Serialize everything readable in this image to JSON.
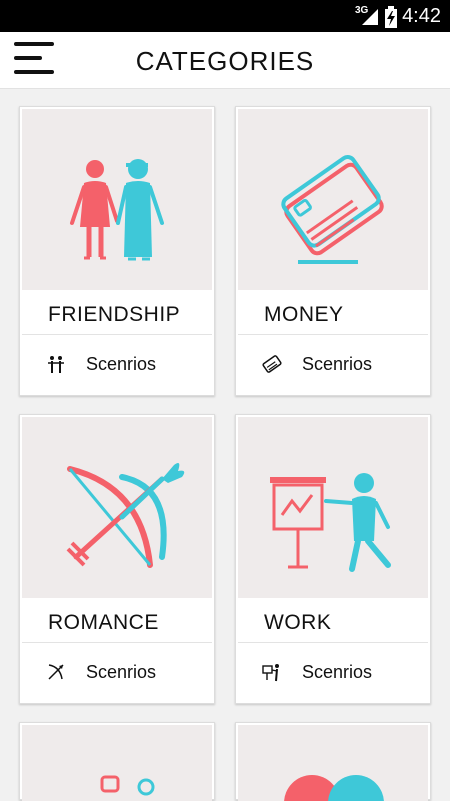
{
  "status_bar": {
    "network": "3G",
    "time": "4:42",
    "icons": [
      "signal-icon",
      "battery-charging-icon"
    ]
  },
  "header": {
    "title": "CATEGORIES",
    "menu_icon": "hamburger-menu-icon"
  },
  "categories": [
    {
      "name": "FRIENDSHIP",
      "scenarios_label": "Scenrios",
      "icon": "friends-icon"
    },
    {
      "name": "MONEY",
      "scenarios_label": "Scenrios",
      "icon": "credit-card-icon"
    },
    {
      "name": "ROMANCE",
      "scenarios_label": "Scenrios",
      "icon": "bow-arrow-icon"
    },
    {
      "name": "WORK",
      "scenarios_label": "Scenrios",
      "icon": "presentation-icon"
    }
  ],
  "colors": {
    "coral": "#f4616a",
    "cyan": "#3ec8d8",
    "card_illustration_bg": "#efebeb",
    "page_bg": "#f1f1f1"
  }
}
